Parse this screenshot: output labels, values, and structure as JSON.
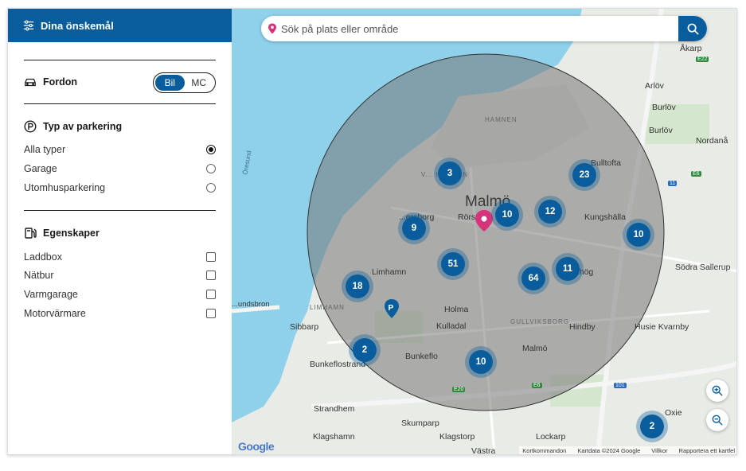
{
  "sidebar": {
    "header": "Dina önskemål",
    "vehicle": {
      "title": "Fordon",
      "options": [
        "Bil",
        "MC"
      ],
      "selected": "Bil"
    },
    "parking_type": {
      "title": "Typ av parkering",
      "options": [
        {
          "label": "Alla typer",
          "checked": true
        },
        {
          "label": "Garage",
          "checked": false
        },
        {
          "label": "Utomhusparkering",
          "checked": false
        }
      ]
    },
    "features": {
      "title": "Egenskaper",
      "options": [
        {
          "label": "Laddbox",
          "checked": false
        },
        {
          "label": "Nätbur",
          "checked": false
        },
        {
          "label": "Varmgarage",
          "checked": false
        },
        {
          "label": "Motorvärmare",
          "checked": false
        }
      ]
    }
  },
  "search": {
    "placeholder": "Sök på plats eller område"
  },
  "map": {
    "clusters": [
      "3",
      "23",
      "10",
      "12",
      "9",
      "10",
      "51",
      "11",
      "64",
      "18",
      "2",
      "10",
      "2"
    ],
    "labels": {
      "akarp": "Åkarp",
      "arlov": "Arlöv",
      "burlov": "Burlöv",
      "burlov2": "Burlöv",
      "nordana": "Nordanå",
      "hamnen": "HAMNEN",
      "vhamnen": "V... HAMNEN",
      "bulltofta": "Bulltofta",
      "malmo": "Malmö",
      "rorsjo": "Rörs",
      "kungshalla": "Kungshälla",
      "borg": "...ersborg",
      "limhamn": "Limhamn",
      "hog": "...hög",
      "sodra_sallerup": "Södra Sallerup",
      "limhamn_small": "LIMHAMN",
      "holma": "Holma",
      "kulladal": "Kulladal",
      "gullviksborg": "GULLVIKSBORG",
      "hindby": "Hindby",
      "husie": "Husie Kvarnby",
      "sibbarp": "Sibbarp",
      "bunkeflo": "Bunkeflo",
      "malmo2": "Malmö",
      "bunkeflostrand": "Bunkeflostrand",
      "strandhem": "Strandhem",
      "skumparp": "Skumparp",
      "oxie": "Oxie",
      "klagshamn": "Klagshamn",
      "klagstorp": "Klagstorp",
      "lockarp": "Lockarp",
      "vastra": "Västra",
      "oresund": "Öresund",
      "sundsbron": "...undsbron",
      "e22": "E22",
      "e6": "E6",
      "e20": "E20",
      "r11": "11",
      "r101": "101",
      "e6b": "E6"
    },
    "google": "Google",
    "attribution": [
      "Kortkommandon",
      "Kartdata ©2024 Google",
      "Villkor",
      "Rapportera ett kartfel"
    ],
    "colors": {
      "water": "#8fd1ea",
      "land": "#e9ece6",
      "radius": "rgba(120,120,120,0.55)",
      "accent": "#0a5d9c",
      "pin": "#d6337a"
    }
  }
}
